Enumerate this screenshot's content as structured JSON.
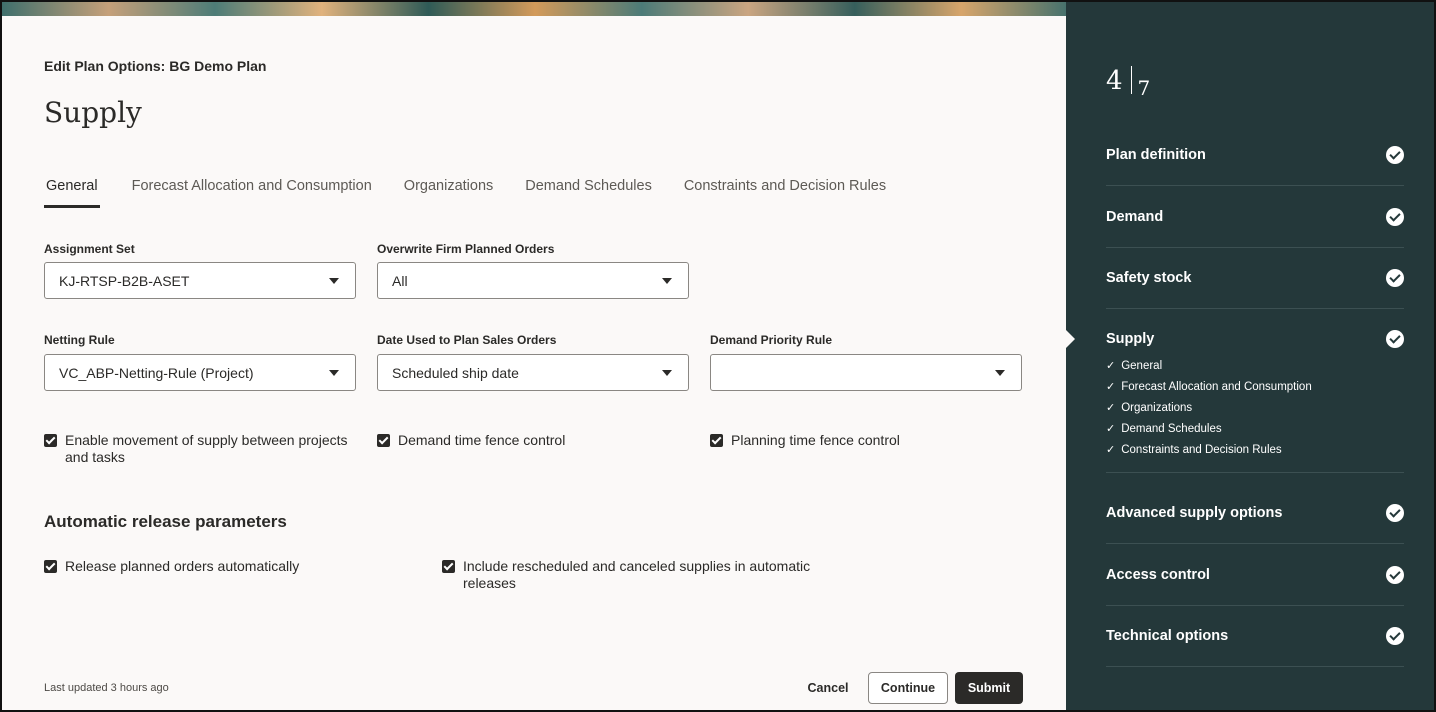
{
  "header": {
    "eyebrow": "Edit Plan Options: BG Demo Plan",
    "title": "Supply"
  },
  "tabs": [
    {
      "label": "General",
      "active": true
    },
    {
      "label": "Forecast Allocation and Consumption",
      "active": false
    },
    {
      "label": "Organizations",
      "active": false
    },
    {
      "label": "Demand Schedules",
      "active": false
    },
    {
      "label": "Constraints and Decision Rules",
      "active": false
    }
  ],
  "fields": {
    "assignment_set": {
      "label": "Assignment Set",
      "value": "KJ-RTSP-B2B-ASET"
    },
    "overwrite_firm": {
      "label": "Overwrite Firm Planned Orders",
      "value": "All"
    },
    "netting_rule": {
      "label": "Netting Rule",
      "value": "VC_ABP-Netting-Rule (Project)"
    },
    "date_used": {
      "label": "Date Used to Plan Sales Orders",
      "value": "Scheduled ship date"
    },
    "demand_priority": {
      "label": "Demand Priority Rule",
      "value": ""
    }
  },
  "checkboxes": {
    "enable_movement": {
      "label": "Enable movement of supply between projects and tasks",
      "checked": true
    },
    "demand_fence": {
      "label": "Demand time fence control",
      "checked": true
    },
    "planning_fence": {
      "label": "Planning time fence control",
      "checked": true
    }
  },
  "release": {
    "title": "Automatic release parameters",
    "release_auto": {
      "label": "Release planned orders automatically",
      "checked": true
    },
    "include_rescheduled": {
      "label": "Include rescheduled and canceled supplies in automatic releases",
      "checked": true
    }
  },
  "footer": {
    "last_updated": "Last updated 3 hours ago",
    "cancel": "Cancel",
    "continue": "Continue",
    "submit": "Submit"
  },
  "sidebar": {
    "current": "4",
    "total": "7",
    "steps": [
      {
        "label": "Plan definition"
      },
      {
        "label": "Demand"
      },
      {
        "label": "Safety stock"
      },
      {
        "label": "Supply",
        "substeps": [
          "General",
          "Forecast Allocation and Consumption",
          "Organizations",
          "Demand Schedules",
          "Constraints and Decision Rules"
        ]
      },
      {
        "label": "Advanced supply options"
      },
      {
        "label": "Access control"
      },
      {
        "label": "Technical options"
      }
    ]
  },
  "colors": {
    "sidebar_bg": "#24383a",
    "page_bg": "#fbf9f8",
    "primary_button": "#2b2a28"
  }
}
